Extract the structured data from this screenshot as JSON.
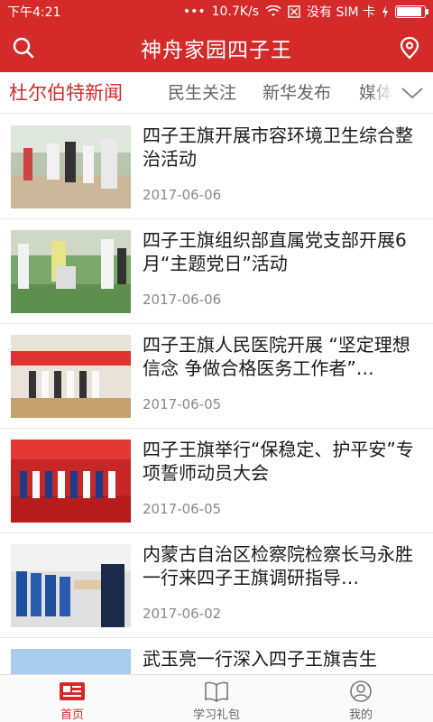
{
  "status_bar": {
    "time": "下午4:21",
    "network_speed": "10.7K/s",
    "no_sim": "没有 SIM 卡",
    "battery_level": 0.9
  },
  "header": {
    "title": "神舟家园四子王",
    "left_icon": "search-icon",
    "right_icon": "location-pin-icon"
  },
  "tabs": [
    {
      "label": "杜尔伯特新闻",
      "active": true
    },
    {
      "label": "民生关注",
      "active": false
    },
    {
      "label": "新华发布",
      "active": false
    },
    {
      "label": "媒体",
      "active": false
    }
  ],
  "news": [
    {
      "title": "四子王旗开展市容环境卫生综合整治活动",
      "date": "2017-06-06"
    },
    {
      "title": "四子王旗组织部直属党支部开展6月“主题党日”活动",
      "date": "2017-06-06"
    },
    {
      "title": "四子王旗人民医院开展 “坚定理想信念 争做合格医务工作者”…",
      "date": "2017-06-05"
    },
    {
      "title": "四子王旗举行“保稳定、护平安”专项誓师动员大会",
      "date": "2017-06-05"
    },
    {
      "title": "内蒙古自治区检察院检察长马永胜一行来四子王旗调研指导…",
      "date": "2017-06-02"
    },
    {
      "title": "武玉亮一行深入四子王旗吉生",
      "date": ""
    }
  ],
  "bottom_nav": [
    {
      "label": "首页",
      "icon": "newspaper-icon",
      "active": true
    },
    {
      "label": "学习礼包",
      "icon": "book-icon",
      "active": false
    },
    {
      "label": "我的",
      "icon": "user-icon",
      "active": false
    }
  ],
  "colors": {
    "brand": "#d42a2a"
  }
}
